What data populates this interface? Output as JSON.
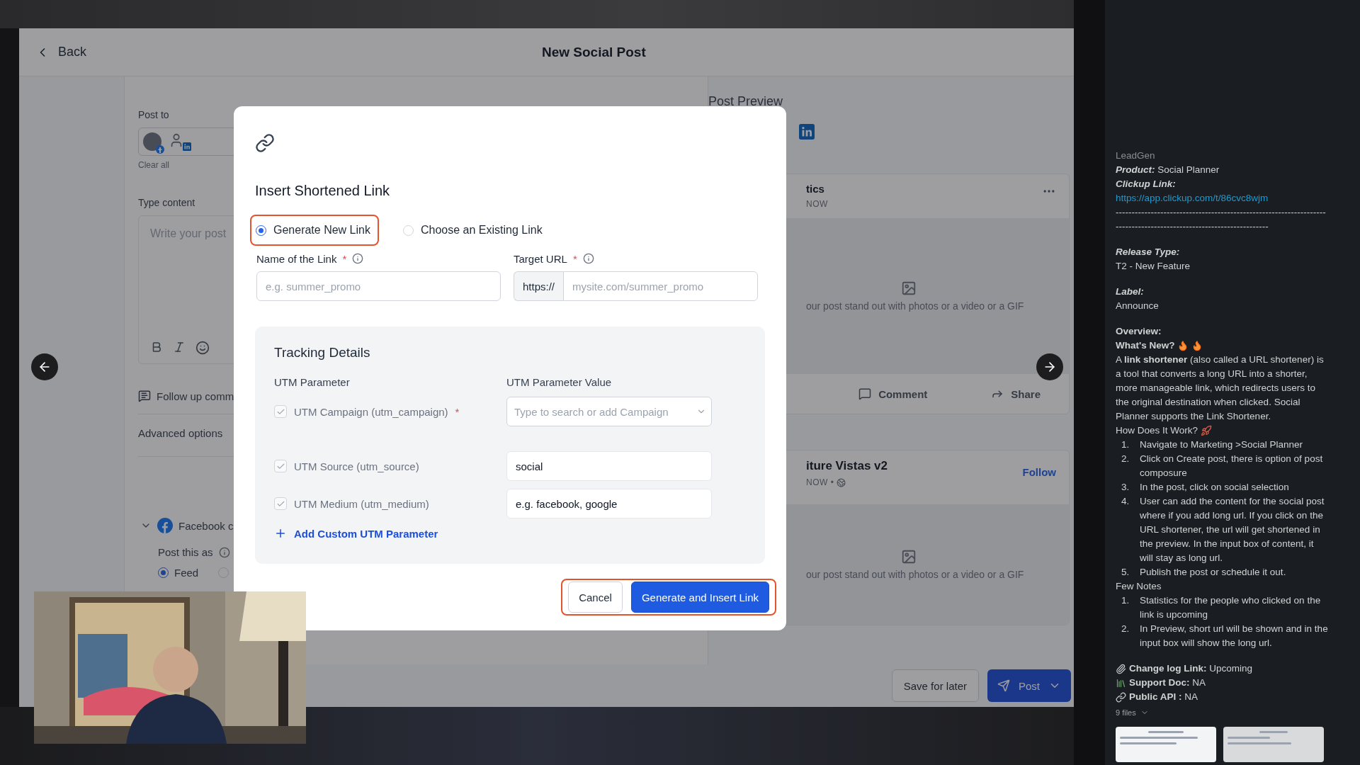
{
  "window": {
    "back": "Back",
    "title": "New Social Post"
  },
  "editor": {
    "post_to_label": "Post to",
    "clear_all": "Clear all",
    "content_label": "Type content",
    "content_placeholder": "Write your post",
    "follow_up": "Follow up comm",
    "advanced": "Advanced options",
    "facebook_section": {
      "title": "Facebook c",
      "expanded": true,
      "post_as_label": "Post this as",
      "options": [
        {
          "label": "Feed",
          "selected": true
        },
        {
          "selected": false
        }
      ]
    }
  },
  "preview": {
    "title": "Post Preview",
    "cards": [
      {
        "name": "tics",
        "time": "NOW",
        "media_hint": "our post stand out with photos or a video or a GIF",
        "actions": [
          "Comment",
          "Share"
        ]
      },
      {
        "name": "iture Vistas v2",
        "time": "NOW •",
        "follow": "Follow",
        "media_hint": "our post stand out with photos or a video or a GIF"
      }
    ]
  },
  "footer": {
    "save": "Save for later",
    "post": "Post"
  },
  "modal": {
    "title": "Insert Shortened Link",
    "modes": [
      {
        "label": "Generate New Link",
        "selected": true,
        "highlighted": true
      },
      {
        "label": "Choose an Existing Link",
        "selected": false,
        "highlighted": false
      }
    ],
    "fields": [
      {
        "label": "Name of the Link",
        "required_mark": "*",
        "placeholder": "e.g. summer_promo"
      },
      {
        "label": "Target URL",
        "required_mark": "*",
        "prefix": "https://",
        "placeholder": "mysite.com/summer_promo"
      }
    ],
    "tracking": {
      "title": "Tracking Details",
      "columns": [
        "UTM Parameter",
        "UTM Parameter Value"
      ],
      "rows": [
        {
          "label": "UTM Campaign (utm_campaign)",
          "required_mark": "*",
          "checked": true,
          "disabled": true,
          "kind": "select",
          "placeholder": "Type to search or add Campaign"
        },
        {
          "label": "UTM Source (utm_source)",
          "checked": true,
          "disabled": true,
          "kind": "input",
          "value": "social"
        },
        {
          "label": "UTM Medium (utm_medium)",
          "checked": true,
          "disabled": true,
          "kind": "input",
          "value": "e.g. facebook, google"
        }
      ],
      "add": "Add Custom UTM Parameter"
    },
    "buttons": [
      {
        "label": "Cancel",
        "kind": "secondary"
      },
      {
        "label": "Generate and Insert Link",
        "kind": "primary"
      }
    ],
    "buttons_highlighted": true
  },
  "notes": {
    "lines": [
      {
        "kind": "muted",
        "text": "LeadGen"
      },
      {
        "kind": "pair",
        "label": "Product:",
        "text": "Social Planner"
      },
      {
        "kind": "pair",
        "label": "Clickup Link:"
      },
      {
        "kind": "link",
        "text": "https://app.clickup.com/t/86cvc8wjm"
      },
      {
        "kind": "rule",
        "text": "------------------------------------------------------------------------------------------------------------------"
      },
      {
        "kind": "pair",
        "label": "Release Type:",
        "space": true
      },
      {
        "kind": "text",
        "text": "T2 - New Feature"
      },
      {
        "kind": "pair",
        "label": "Label:",
        "space": true
      },
      {
        "kind": "text",
        "text": "Announce"
      },
      {
        "kind": "bold",
        "text": "Overview:",
        "space": true
      },
      {
        "kind": "fire",
        "text": "What's New?"
      },
      {
        "kind": "para",
        "text": "A **link shortener** (also called a URL shortener) is a tool that converts a long URL into a shorter, more manageable link, which redirects users to the original destination when clicked. Social Planner supports the Link Shortener."
      },
      {
        "kind": "rocket",
        "text": "How Does It Work?"
      },
      {
        "kind": "list",
        "items": [
          {
            "number": "1.",
            "text": "Navigate to Marketing >Social Planner"
          },
          {
            "number": "2.",
            "text": "Click on Create post, there is option of post composure"
          },
          {
            "number": "3.",
            "text": "In the post, click on social selection"
          },
          {
            "number": "4.",
            "text": "User can add the content for the social post where if you add long url. If you click on the URL shortener, the url will get shortened in the preview. In the input box of content, it will stay as long url."
          },
          {
            "number": "5.",
            "text": "Publish the post or schedule it out."
          }
        ]
      },
      {
        "kind": "text",
        "text": "Few Notes"
      },
      {
        "kind": "list",
        "items": [
          {
            "number": "1.",
            "text": "Statistics for the people who clicked on the link is upcoming"
          },
          {
            "number": "2.",
            "text": "In Preview, short url will be shown and in the input box will show the long url."
          }
        ]
      },
      {
        "kind": "clip",
        "label": "Change log Link:",
        "text": "Upcoming",
        "space": true
      },
      {
        "kind": "books",
        "label": "Support Doc:",
        "text": "NA"
      },
      {
        "kind": "chain",
        "label": "Public API :",
        "text": "NA"
      },
      {
        "kind": "files",
        "text": "9 files"
      }
    ]
  }
}
